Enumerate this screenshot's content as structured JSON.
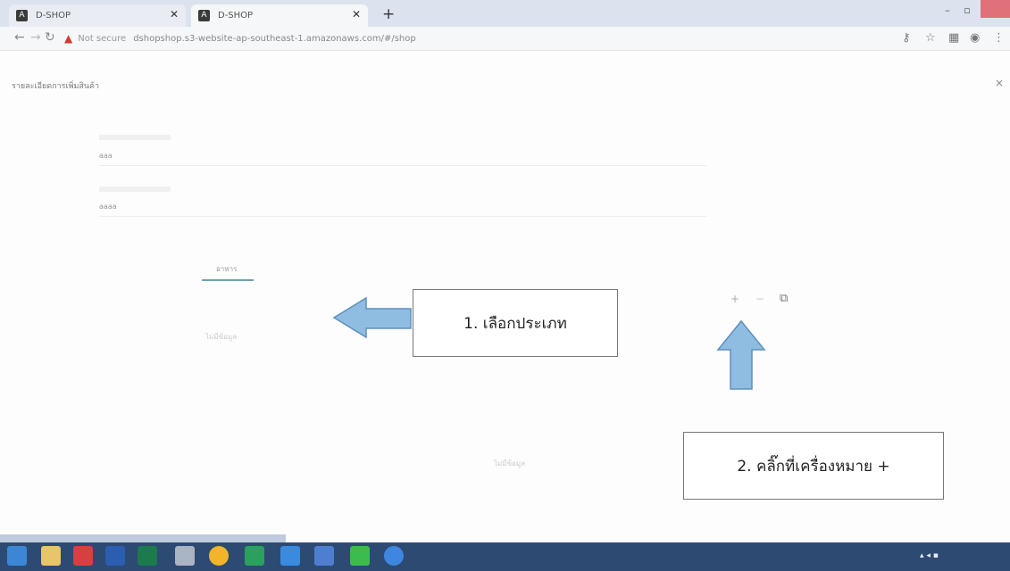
{
  "browser": {
    "tabs": [
      {
        "title": "D-SHOP",
        "favicon": "angular-icon"
      },
      {
        "title": "D-SHOP",
        "favicon": "angular-icon"
      }
    ],
    "new_tab": "+",
    "address": {
      "security_label": "Not secure",
      "url": "dshopshop.s3-website-ap-southeast-1.amazonaws.com/#/shop"
    }
  },
  "modal": {
    "title": "รายละเอียดการเพิ่มสินค้า",
    "close": "×",
    "fields": [
      {
        "value": "aaa"
      },
      {
        "value": "aaaa"
      }
    ],
    "category_tabs": [
      {
        "label": "อาหาร",
        "active": true
      },
      {
        "label": "",
        "active": false
      },
      {
        "label": "",
        "active": false
      },
      {
        "label": "",
        "active": false
      },
      {
        "label": "",
        "active": false
      },
      {
        "label": "",
        "active": false
      }
    ],
    "actions": {
      "add": "+",
      "minus": "−"
    },
    "empty_left": "ไม่มีข้อมูล",
    "empty_bottom": "ไม่มีข้อมูล"
  },
  "annotations": {
    "step1": "1. เลือกประเภท",
    "step2": "2. คลิ๊กที่เครื่องหมาย +"
  },
  "colors": {
    "arrow": "#7fb0da",
    "tab_underline": "#6ea3aa",
    "taskbar": "#2d4a73",
    "not_secure": "#d23b2e"
  }
}
